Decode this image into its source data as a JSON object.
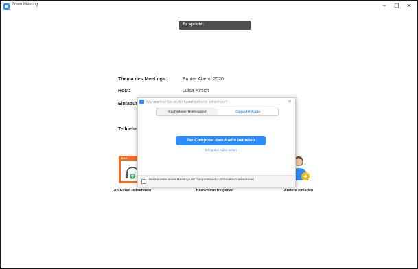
{
  "window": {
    "title": "Zoom Meeting",
    "minimize": "–",
    "maximize": "❐",
    "close": "✕"
  },
  "speaker": {
    "label": "Es spricht:"
  },
  "meeting": {
    "topic_label": "Thema des Meetings:",
    "topic_value": "Bunter Abend 2020",
    "host_label": "Host:",
    "host_value": "Luisa Kirsch",
    "invite_label": "Einladun",
    "participant_label": "Teilnehm"
  },
  "actions": [
    {
      "label": "An Audio teilnehmen",
      "icon": "headset-icon"
    },
    {
      "label": "Bildschirm freigeben",
      "icon": "share-screen-icon"
    },
    {
      "label": "Andere einladen",
      "icon": "invite-person-icon"
    }
  ],
  "audio_dialog": {
    "title": "Wie möchten Sie an der Audiokonferenz teilnehmen?",
    "tabs": [
      "Kostenloser Telefonanruf",
      "Computer Audio"
    ],
    "active_tab": "Computer Audio",
    "join_button": "Per Computer dem Audio beitreten",
    "test_link": "Computer Audio testen",
    "auto_join_checkbox": "Bei Betreten eines Meetings an Computeraudio automatisch teilnehmen",
    "auto_join_checked": false
  },
  "colors": {
    "accent": "#2d8cff",
    "orange": "#f26d21",
    "speaker_bg": "#4f4f52"
  }
}
